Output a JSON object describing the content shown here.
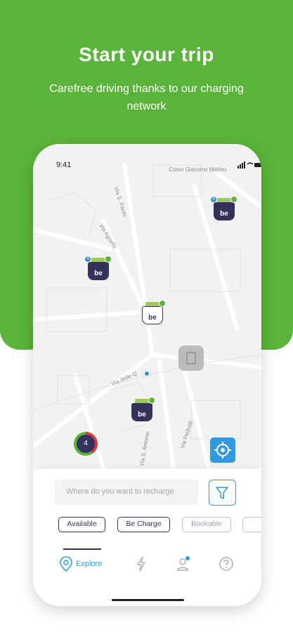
{
  "hero": {
    "title": "Start your trip",
    "subtitle": "Carefree driving thanks to our charging network"
  },
  "status_bar": {
    "time": "9:41"
  },
  "map": {
    "streets": [
      "Corso Giacomo Matteo",
      "Via S. Paolo",
      "Via Agnello",
      "Via delle Q",
      "Via Pedrotti",
      "Via S. Antonio"
    ],
    "pin_label": "be",
    "cluster_count": "4"
  },
  "search": {
    "placeholder": "Where do you want to recharge"
  },
  "filters": [
    {
      "label": "Available",
      "active": true
    },
    {
      "label": "Be Charge",
      "active": true
    },
    {
      "label": "Bookable",
      "active": false
    },
    {
      "label": "",
      "active": false
    }
  ],
  "nav": {
    "items": [
      {
        "label": "Explore",
        "icon": "explore-pin-icon",
        "active": true
      },
      {
        "label": "",
        "icon": "charge-bolt-icon",
        "active": false
      },
      {
        "label": "",
        "icon": "profile-icon",
        "active": false
      },
      {
        "label": "",
        "icon": "help-icon",
        "active": false
      }
    ]
  },
  "colors": {
    "brand_green": "#5ab43a",
    "navy": "#33325c",
    "accent_blue": "#2f9ae0",
    "alert_red": "#d73a3a"
  }
}
